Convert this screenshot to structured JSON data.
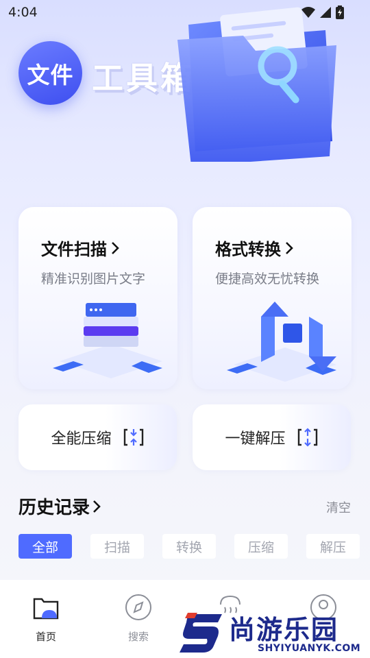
{
  "status_bar": {
    "time": "4:04"
  },
  "hero": {
    "logo_text": "文件",
    "title": "工具箱"
  },
  "cards": {
    "scan": {
      "title": "文件扫描",
      "subtitle": "精准识别图片文字"
    },
    "convert": {
      "title": "格式转换",
      "subtitle": "便捷高效无忧转换"
    },
    "compress": {
      "label": "全能压缩"
    },
    "decompress": {
      "label": "一键解压"
    }
  },
  "history": {
    "title": "历史记录",
    "clear_label": "清空",
    "filters": [
      "全部",
      "扫描",
      "转换",
      "压缩",
      "解压"
    ],
    "active_filter": "全部"
  },
  "bottom_nav": {
    "items": [
      {
        "label": "首页",
        "icon": "folder-icon",
        "active": true
      },
      {
        "label": "搜索",
        "icon": "compass-icon",
        "active": false
      },
      {
        "label": "",
        "icon": "signal-icon",
        "active": false
      },
      {
        "label": "",
        "icon": "user-icon",
        "active": false
      }
    ]
  },
  "watermark": {
    "text": "尚游乐园",
    "url": "SHYIYUANYK.COM"
  },
  "colors": {
    "accent": "#4f6bff",
    "logo": "#3e4ff0",
    "watermark": "#1d2a8c"
  }
}
